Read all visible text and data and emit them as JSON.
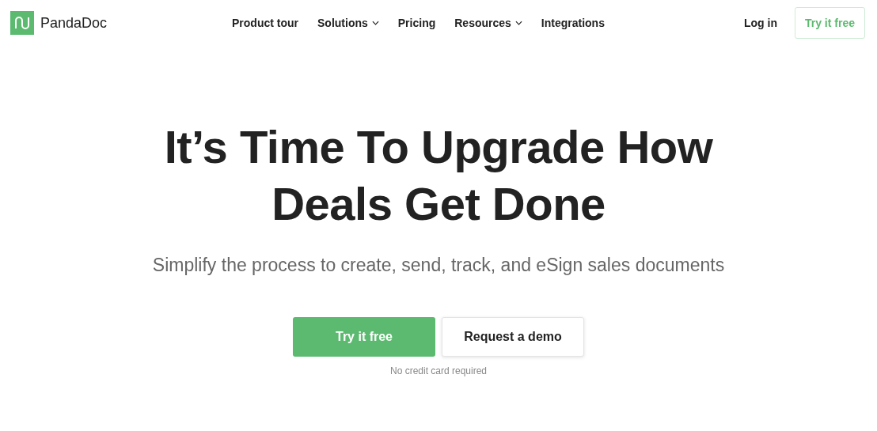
{
  "brand": {
    "name": "PandaDoc"
  },
  "nav": [
    {
      "label": "Product tour",
      "dropdown": false
    },
    {
      "label": "Solutions",
      "dropdown": true
    },
    {
      "label": "Pricing",
      "dropdown": false
    },
    {
      "label": "Resources",
      "dropdown": true
    },
    {
      "label": "Integrations",
      "dropdown": false
    }
  ],
  "header_actions": {
    "login": "Log in",
    "trial": "Try it free"
  },
  "hero": {
    "headline_lines": [
      "It’s Time To Upgrade How",
      "Deals Get Done"
    ],
    "subtitle": "Simplify the process to create, send, track, and eSign sales documents",
    "primary_button": "Try it free",
    "secondary_button": "Request a demo",
    "note": "No credit card required"
  }
}
